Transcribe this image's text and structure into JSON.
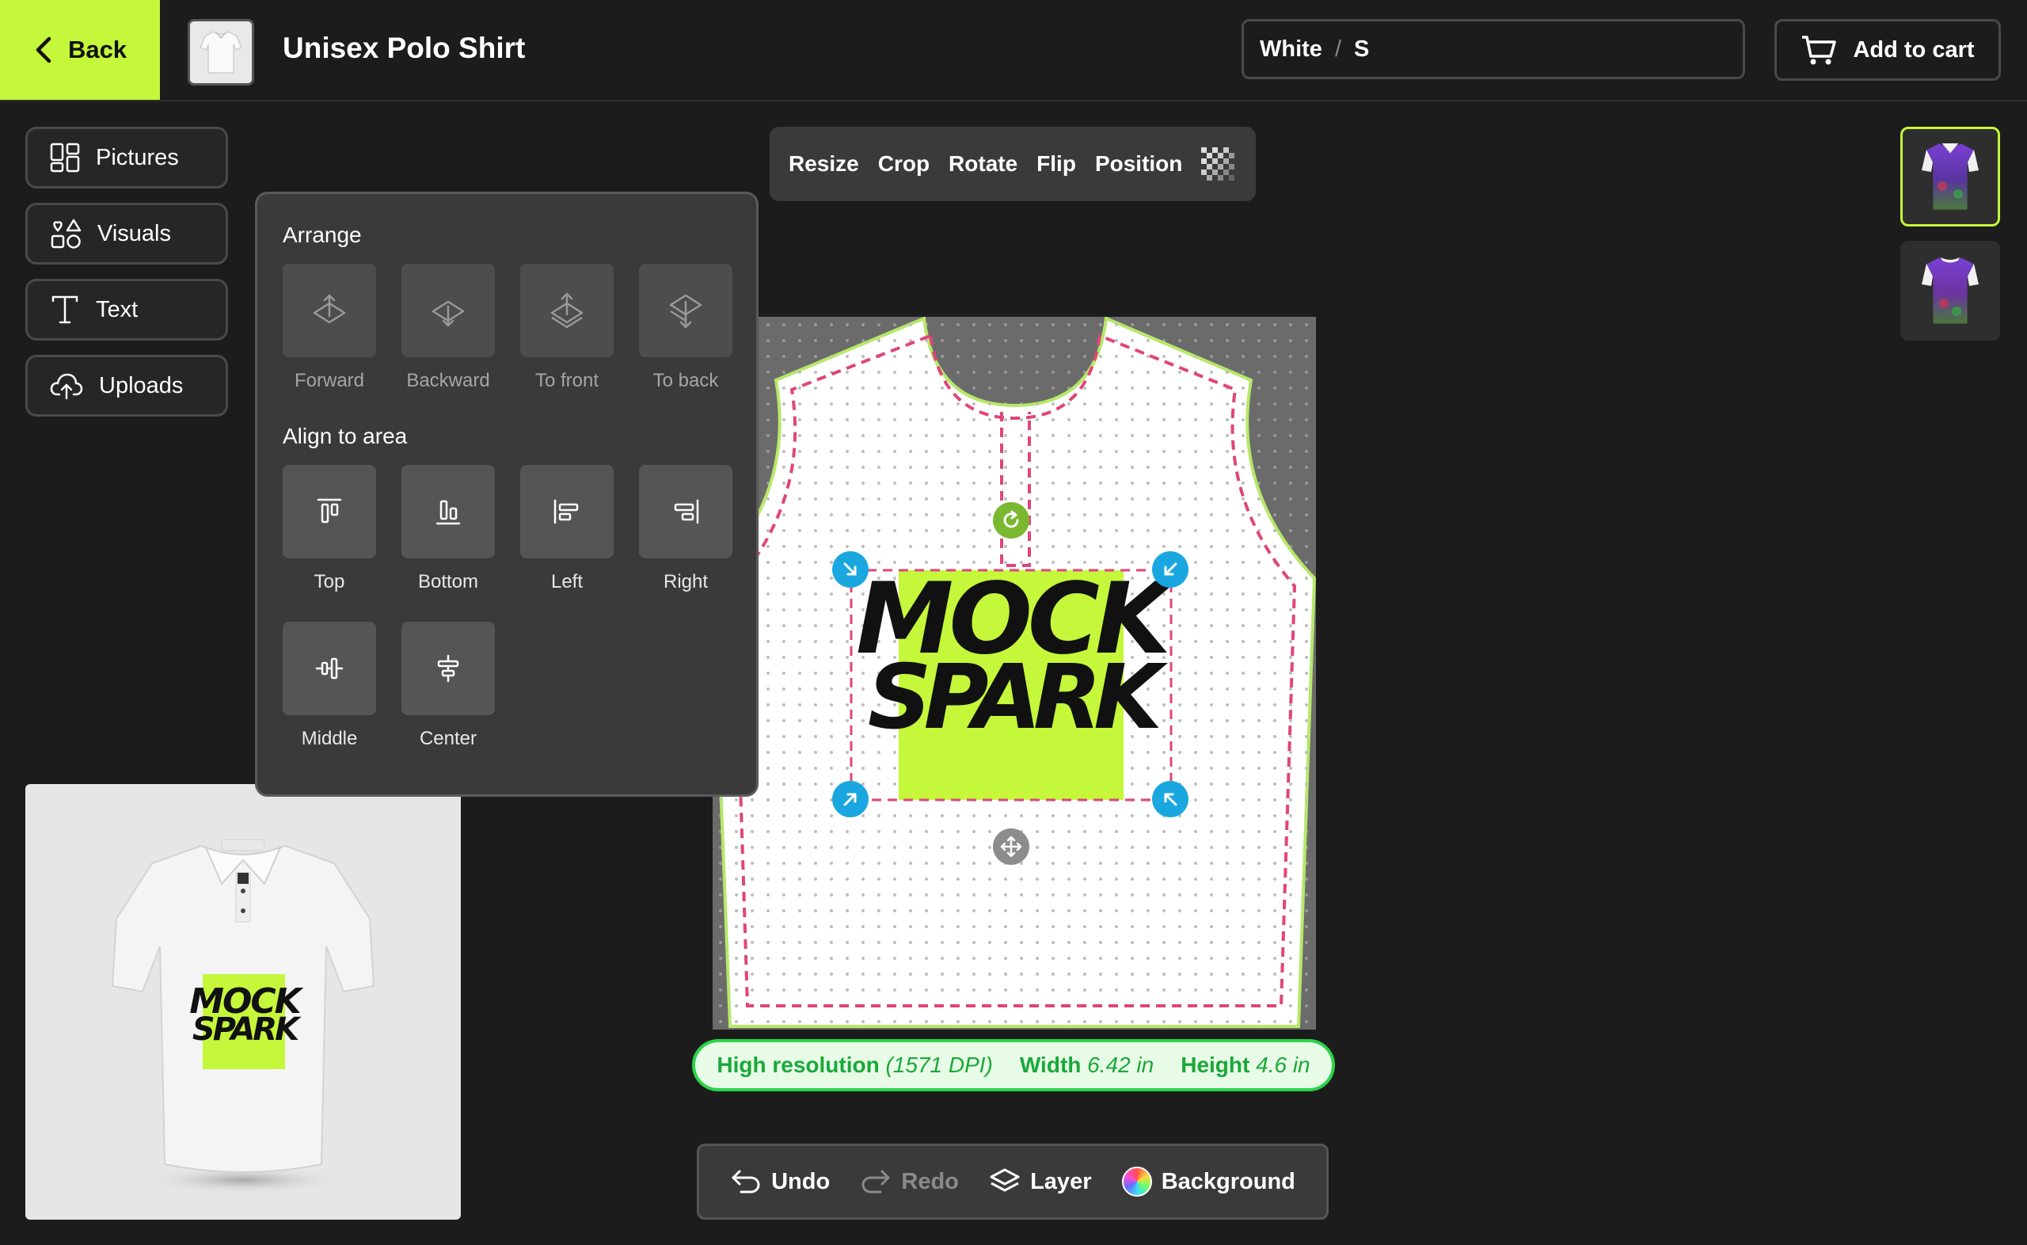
{
  "header": {
    "back_label": "Back",
    "product_title": "Unisex Polo Shirt",
    "variant_color": "White",
    "variant_separator": "/",
    "variant_size": "S",
    "add_to_cart_label": "Add to cart"
  },
  "sidebar": {
    "items": [
      {
        "label": "Pictures",
        "icon": "grid-icon"
      },
      {
        "label": "Visuals",
        "icon": "shapes-icon"
      },
      {
        "label": "Text",
        "icon": "text-icon"
      },
      {
        "label": "Uploads",
        "icon": "cloud-upload-icon"
      }
    ]
  },
  "arrange_panel": {
    "arrange_heading": "Arrange",
    "arrange_items": [
      {
        "label": "Forward",
        "icon": "bring-forward-icon",
        "enabled": false
      },
      {
        "label": "Backward",
        "icon": "send-backward-icon",
        "enabled": false
      },
      {
        "label": "To front",
        "icon": "bring-to-front-icon",
        "enabled": false
      },
      {
        "label": "To back",
        "icon": "send-to-back-icon",
        "enabled": false
      }
    ],
    "align_heading": "Align to area",
    "align_items": [
      {
        "label": "Top",
        "icon": "align-top-icon"
      },
      {
        "label": "Bottom",
        "icon": "align-bottom-icon"
      },
      {
        "label": "Left",
        "icon": "align-left-icon"
      },
      {
        "label": "Right",
        "icon": "align-right-icon"
      },
      {
        "label": "Middle",
        "icon": "align-middle-icon"
      },
      {
        "label": "Center",
        "icon": "align-center-icon"
      }
    ]
  },
  "edit_toolbar": {
    "items": [
      "Resize",
      "Crop",
      "Rotate",
      "Flip",
      "Position"
    ],
    "transparency_icon": "checker-icon"
  },
  "design": {
    "logo_line1": "MOCK",
    "logo_line2": "SPARK",
    "accent_color": "#c5f73a"
  },
  "info_bar": {
    "resolution_label": "High resolution",
    "dpi": "(1571 DPI)",
    "width_label": "Width",
    "width_value": "6.42 in",
    "height_label": "Height",
    "height_value": "4.6 in"
  },
  "bottom_toolbar": {
    "undo": "Undo",
    "redo": "Redo",
    "layer": "Layer",
    "background": "Background"
  },
  "colors": {
    "brand_lime": "#c5f73a",
    "handle_blue": "#1aa7e0",
    "rotate_green": "#7ab830",
    "safe_line_pink": "#e0457a",
    "success_green": "#2bd34a"
  }
}
